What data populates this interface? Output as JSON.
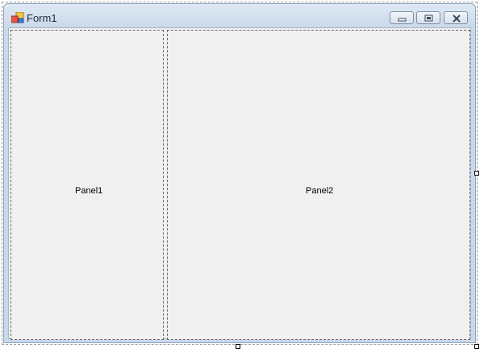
{
  "form": {
    "title": "Form1",
    "icon": "form-icon",
    "caption_buttons": [
      "minimize-icon",
      "maximize-icon",
      "close-icon"
    ]
  },
  "panels": [
    {
      "label": "Panel1"
    },
    {
      "label": "Panel2"
    }
  ],
  "colors": {
    "client_background": "#f0f0f0",
    "title_bar": "#c9d8ea",
    "panel_border": "#6b6b6b"
  }
}
